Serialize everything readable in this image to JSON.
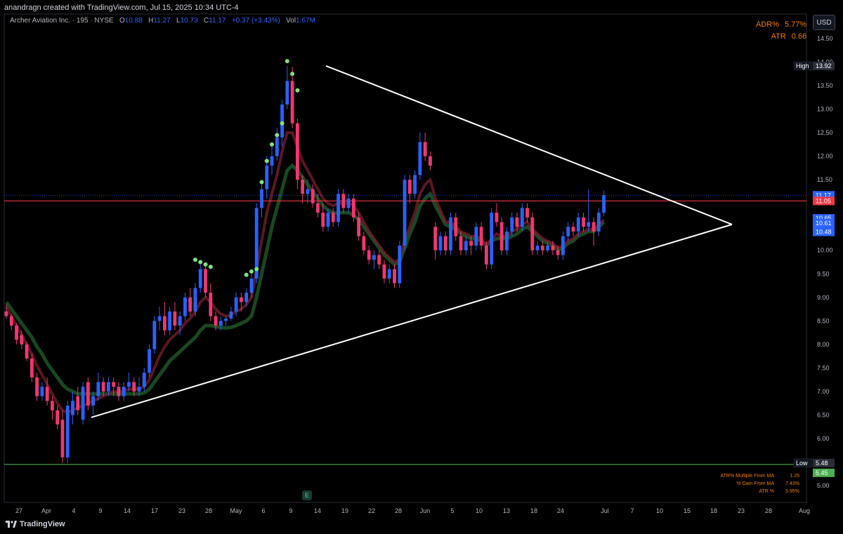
{
  "header": {
    "attribution": "anandragn created with TradingView.com, Jul 15, 2025 10:34 UTC-4"
  },
  "legend": {
    "symbol": "Archer Aviation Inc. · 195 · NYSE",
    "o_label": "O",
    "o_value": "10.88",
    "h_label": "H",
    "h_value": "11.27",
    "l_label": "L",
    "l_value": "10.73",
    "c_label": "C",
    "c_value": "11.17",
    "change": "+0.37 (+3.43%)",
    "vol_label": "Vol",
    "vol_value": "1.67M"
  },
  "currency_button": "USD",
  "indicators": {
    "adr_label": "ADR%",
    "adr_value": "5.77%",
    "atr_label": "ATR",
    "atr_value": "0.66"
  },
  "stats": [
    {
      "label": "ATR% Multiple From MA",
      "value": "1.25"
    },
    {
      "label": "% Gain From MA",
      "value": "7.43%"
    },
    {
      "label": "ATR %",
      "value": "5.95%"
    }
  ],
  "brand": "TradingView",
  "earnings_marker": "E",
  "colors": {
    "up": "#2962ff",
    "down": "#f23670",
    "red_line": "#f23645",
    "green_line": "#4caf50",
    "triangle": "#ffffff",
    "dots": "#7ee37e",
    "ema_fast": "#7a1f2b",
    "ema_green": "#1e5a28"
  },
  "chart_data": {
    "type": "candlestick",
    "title": "Archer Aviation Inc. · 195 · NYSE",
    "y_axis": {
      "min": 5.0,
      "max": 14.5,
      "ticks": [
        "14.50",
        "14.00",
        "13.50",
        "13.00",
        "12.50",
        "12.00",
        "11.50",
        "11.00",
        "10.50",
        "10.00",
        "9.50",
        "9.00",
        "8.50",
        "8.00",
        "7.50",
        "7.00",
        "6.50",
        "6.00",
        "5.50",
        "5.00"
      ]
    },
    "x_axis": {
      "ticks": [
        "27",
        "Apr",
        "4",
        "9",
        "14",
        "17",
        "23",
        "28",
        "May",
        "6",
        "9",
        "14",
        "19",
        "22",
        "28",
        "Jun",
        "5",
        "10",
        "13",
        "18",
        "24",
        "Jul",
        "7",
        "10",
        "15",
        "18",
        "23",
        "28",
        "Aug"
      ]
    },
    "price_labels": [
      {
        "text": "High",
        "value": "13.92",
        "price": 13.92,
        "color": "#2a2e39"
      },
      {
        "text": "",
        "value": "11.17",
        "price": 11.17,
        "color": "#2962ff"
      },
      {
        "text": "",
        "value": "11.05",
        "price": 11.05,
        "color": "#f23645"
      },
      {
        "text": "",
        "value": "10.65",
        "price": 10.65,
        "color": "#2962ff"
      },
      {
        "text": "",
        "value": "10.61",
        "price": 10.61,
        "color": "#2962ff"
      },
      {
        "text": "",
        "value": "10.49",
        "price": 10.49,
        "color": "#2962ff"
      },
      {
        "text": "",
        "value": "10.48",
        "price": 10.48,
        "color": "#2962ff"
      },
      {
        "text": "Low",
        "value": "5.48",
        "price": 5.48,
        "color": "#2a2e39"
      },
      {
        "text": "",
        "value": "5.45",
        "price": 5.45,
        "color": "#4caf50"
      }
    ],
    "horizontal_lines": [
      {
        "price": 11.05,
        "color": "#f23645"
      },
      {
        "price": 5.45,
        "color": "#4caf50"
      }
    ],
    "trendlines": [
      {
        "from": [
          0.248,
          13.92
        ],
        "to": [
          1.0,
          10.55
        ]
      },
      {
        "from": [
          0.06,
          6.45
        ],
        "to": [
          1.0,
          10.55
        ]
      }
    ],
    "candles": [
      [
        8.7,
        8.85,
        8.55,
        8.6
      ],
      [
        8.6,
        8.65,
        8.3,
        8.4
      ],
      [
        8.4,
        8.45,
        8.0,
        8.1
      ],
      [
        8.2,
        8.3,
        7.9,
        8.0
      ],
      [
        8.0,
        8.05,
        7.65,
        7.7
      ],
      [
        7.7,
        7.8,
        7.2,
        7.3
      ],
      [
        7.3,
        7.4,
        6.8,
        6.9
      ],
      [
        6.9,
        7.2,
        6.8,
        7.1
      ],
      [
        7.1,
        7.3,
        6.7,
        6.8
      ],
      [
        6.8,
        6.9,
        6.4,
        6.6
      ],
      [
        6.6,
        6.7,
        6.2,
        6.3
      ],
      [
        6.4,
        6.6,
        5.48,
        5.6
      ],
      [
        5.6,
        6.8,
        5.48,
        6.7
      ],
      [
        6.5,
        7.0,
        6.3,
        6.8
      ],
      [
        6.9,
        7.1,
        6.5,
        6.6
      ],
      [
        6.4,
        7.2,
        6.3,
        7.1
      ],
      [
        7.2,
        7.3,
        6.6,
        6.7
      ],
      [
        6.7,
        7.0,
        6.5,
        6.9
      ],
      [
        6.9,
        7.4,
        6.8,
        7.2
      ],
      [
        7.2,
        7.3,
        6.9,
        7.0
      ],
      [
        7.0,
        7.3,
        6.9,
        7.2
      ],
      [
        7.2,
        7.3,
        6.9,
        7.1
      ],
      [
        7.1,
        7.2,
        6.8,
        6.9
      ],
      [
        6.9,
        7.2,
        6.8,
        7.1
      ],
      [
        7.1,
        7.4,
        7.0,
        7.2
      ],
      [
        7.2,
        7.3,
        6.9,
        7.0
      ],
      [
        7.0,
        7.3,
        6.9,
        7.1
      ],
      [
        7.1,
        7.5,
        7.0,
        7.4
      ],
      [
        7.4,
        8.0,
        7.3,
        7.9
      ],
      [
        7.9,
        8.6,
        7.8,
        8.5
      ],
      [
        8.5,
        8.8,
        8.3,
        8.6
      ],
      [
        8.6,
        8.9,
        8.2,
        8.3
      ],
      [
        8.3,
        8.8,
        8.2,
        8.7
      ],
      [
        8.7,
        8.9,
        8.3,
        8.4
      ],
      [
        8.4,
        8.7,
        8.2,
        8.6
      ],
      [
        8.6,
        9.1,
        8.5,
        9.0
      ],
      [
        9.0,
        9.2,
        8.6,
        8.7
      ],
      [
        8.7,
        9.3,
        8.6,
        9.2
      ],
      [
        9.2,
        9.7,
        9.1,
        9.6
      ],
      [
        9.6,
        9.7,
        9.0,
        9.1
      ],
      [
        9.1,
        9.3,
        8.5,
        8.6
      ],
      [
        8.6,
        8.7,
        8.3,
        8.4
      ],
      [
        8.4,
        8.6,
        8.3,
        8.5
      ],
      [
        8.5,
        8.6,
        8.4,
        8.55
      ],
      [
        8.55,
        8.8,
        8.5,
        8.7
      ],
      [
        8.7,
        9.1,
        8.6,
        9.0
      ],
      [
        9.0,
        9.1,
        8.7,
        8.9
      ],
      [
        8.9,
        9.2,
        8.8,
        9.1
      ],
      [
        9.1,
        9.5,
        9.0,
        9.4
      ],
      [
        9.4,
        11.0,
        9.3,
        10.9
      ],
      [
        10.9,
        11.4,
        10.7,
        11.3
      ],
      [
        11.3,
        12.0,
        11.1,
        11.8
      ],
      [
        11.8,
        12.3,
        11.6,
        12.0
      ],
      [
        12.0,
        12.6,
        11.9,
        12.4
      ],
      [
        12.4,
        13.2,
        12.2,
        13.1
      ],
      [
        13.1,
        13.92,
        13.0,
        13.6
      ],
      [
        13.6,
        13.9,
        12.6,
        12.7
      ],
      [
        12.7,
        12.8,
        11.3,
        11.5
      ],
      [
        11.5,
        11.6,
        11.0,
        11.2
      ],
      [
        11.2,
        11.5,
        11.0,
        11.3
      ],
      [
        11.3,
        11.4,
        10.9,
        11.0
      ],
      [
        11.0,
        11.2,
        10.7,
        10.8
      ],
      [
        10.8,
        11.0,
        10.4,
        10.5
      ],
      [
        10.5,
        10.9,
        10.4,
        10.8
      ],
      [
        10.8,
        10.9,
        10.5,
        10.6
      ],
      [
        10.6,
        11.3,
        10.5,
        11.2
      ],
      [
        11.2,
        11.3,
        10.8,
        10.9
      ],
      [
        10.9,
        11.2,
        10.8,
        11.1
      ],
      [
        11.1,
        11.2,
        10.6,
        10.7
      ],
      [
        10.7,
        10.8,
        10.2,
        10.3
      ],
      [
        10.3,
        10.4,
        9.9,
        10.0
      ],
      [
        10.0,
        10.1,
        9.7,
        9.8
      ],
      [
        9.8,
        10.0,
        9.6,
        9.9
      ],
      [
        9.9,
        10.0,
        9.6,
        9.7
      ],
      [
        9.7,
        9.8,
        9.3,
        9.4
      ],
      [
        9.4,
        9.7,
        9.3,
        9.6
      ],
      [
        9.6,
        9.7,
        9.2,
        9.3
      ],
      [
        9.3,
        10.2,
        9.2,
        10.1
      ],
      [
        10.1,
        11.6,
        10.0,
        11.5
      ],
      [
        11.5,
        11.6,
        11.0,
        11.2
      ],
      [
        11.2,
        11.7,
        11.1,
        11.6
      ],
      [
        11.6,
        12.5,
        11.5,
        12.3
      ],
      [
        12.3,
        12.5,
        11.9,
        12.0
      ],
      [
        12.0,
        12.1,
        11.7,
        11.8
      ],
      [
        10.5,
        10.6,
        9.8,
        10.0
      ],
      [
        10.0,
        10.4,
        9.9,
        10.3
      ],
      [
        10.3,
        10.4,
        9.9,
        10.0
      ],
      [
        10.0,
        10.8,
        9.9,
        10.7
      ],
      [
        10.7,
        10.8,
        10.2,
        10.3
      ],
      [
        10.3,
        10.4,
        9.9,
        10.0
      ],
      [
        10.0,
        10.3,
        9.9,
        10.2
      ],
      [
        10.2,
        10.3,
        9.9,
        10.1
      ],
      [
        10.1,
        10.6,
        10.0,
        10.5
      ],
      [
        10.5,
        10.6,
        10.0,
        10.1
      ],
      [
        10.1,
        10.2,
        9.6,
        9.7
      ],
      [
        9.7,
        10.9,
        9.6,
        10.8
      ],
      [
        10.8,
        11.0,
        10.5,
        10.6
      ],
      [
        10.6,
        10.7,
        9.9,
        10.0
      ],
      [
        10.0,
        10.5,
        9.9,
        10.4
      ],
      [
        10.4,
        10.8,
        10.3,
        10.7
      ],
      [
        10.7,
        10.8,
        10.4,
        10.5
      ],
      [
        10.5,
        11.0,
        10.4,
        10.9
      ],
      [
        10.9,
        11.0,
        10.6,
        10.7
      ],
      [
        10.7,
        10.8,
        9.9,
        10.0
      ],
      [
        10.0,
        10.2,
        9.9,
        10.1
      ],
      [
        10.1,
        10.2,
        9.9,
        10.0
      ],
      [
        10.0,
        10.2,
        9.95,
        10.1
      ],
      [
        10.1,
        10.2,
        9.9,
        10.0
      ],
      [
        10.0,
        10.1,
        9.8,
        9.9
      ],
      [
        9.9,
        10.4,
        9.8,
        10.3
      ],
      [
        10.3,
        10.6,
        10.2,
        10.5
      ],
      [
        10.5,
        10.6,
        10.3,
        10.4
      ],
      [
        10.4,
        10.8,
        10.3,
        10.7
      ],
      [
        10.7,
        10.8,
        10.4,
        10.5
      ],
      [
        10.5,
        11.3,
        10.4,
        10.6
      ],
      [
        10.6,
        10.7,
        10.1,
        10.4
      ],
      [
        10.4,
        10.9,
        10.3,
        10.8
      ],
      [
        10.8,
        11.27,
        10.73,
        11.17
      ]
    ],
    "ema_fast": [
      8.8,
      8.6,
      8.4,
      8.2,
      8.0,
      7.8,
      7.55,
      7.35,
      7.15,
      6.95,
      6.75,
      6.6,
      6.55,
      6.6,
      6.65,
      6.7,
      6.75,
      6.8,
      6.85,
      6.9,
      6.95,
      7.0,
      7.0,
      7.0,
      7.05,
      7.05,
      7.05,
      7.1,
      7.25,
      7.5,
      7.75,
      7.95,
      8.1,
      8.2,
      8.3,
      8.45,
      8.55,
      8.7,
      8.9,
      9.0,
      8.9,
      8.75,
      8.65,
      8.6,
      8.62,
      8.7,
      8.75,
      8.85,
      9.0,
      9.6,
      10.2,
      10.8,
      11.2,
      11.6,
      12.1,
      12.5,
      12.5,
      12.2,
      11.9,
      11.7,
      11.5,
      11.3,
      11.1,
      11.0,
      10.95,
      11.0,
      11.0,
      11.0,
      10.95,
      10.8,
      10.6,
      10.4,
      10.25,
      10.1,
      9.95,
      9.85,
      9.75,
      9.8,
      10.2,
      10.5,
      10.8,
      11.2,
      11.4,
      11.5,
      11.1,
      10.85,
      10.6,
      10.6,
      10.5,
      10.4,
      10.35,
      10.3,
      10.3,
      10.25,
      10.1,
      10.25,
      10.35,
      10.3,
      10.3,
      10.4,
      10.45,
      10.55,
      10.6,
      10.45,
      10.35,
      10.25,
      10.2,
      10.15,
      10.05,
      10.1,
      10.2,
      10.25,
      10.35,
      10.4,
      10.45,
      10.45,
      10.55,
      10.65
    ],
    "ema_green": [
      8.9,
      8.75,
      8.6,
      8.45,
      8.3,
      8.15,
      7.95,
      7.8,
      7.6,
      7.45,
      7.3,
      7.15,
      7.05,
      7.0,
      6.95,
      6.95,
      6.95,
      6.95,
      6.95,
      6.95,
      6.95,
      6.95,
      6.95,
      6.95,
      6.95,
      6.95,
      6.95,
      6.97,
      7.05,
      7.2,
      7.35,
      7.5,
      7.65,
      7.75,
      7.85,
      7.95,
      8.05,
      8.15,
      8.3,
      8.4,
      8.4,
      8.38,
      8.36,
      8.35,
      8.36,
      8.4,
      8.45,
      8.5,
      8.6,
      9.0,
      9.5,
      10.0,
      10.5,
      10.9,
      11.3,
      11.7,
      11.8,
      11.7,
      11.55,
      11.4,
      11.25,
      11.1,
      10.95,
      10.85,
      10.8,
      10.8,
      10.8,
      10.8,
      10.75,
      10.65,
      10.5,
      10.35,
      10.2,
      10.05,
      9.9,
      9.8,
      9.7,
      9.75,
      10.05,
      10.35,
      10.6,
      10.95,
      11.1,
      11.2,
      10.95,
      10.75,
      10.55,
      10.5,
      10.45,
      10.35,
      10.3,
      10.25,
      10.25,
      10.2,
      10.1,
      10.2,
      10.25,
      10.25,
      10.25,
      10.3,
      10.35,
      10.45,
      10.5,
      10.4,
      10.3,
      10.2,
      10.15,
      10.1,
      10.0,
      10.05,
      10.15,
      10.2,
      10.3,
      10.35,
      10.4,
      10.4,
      10.5,
      10.6
    ],
    "signal_dots": [
      [
        37,
        9.8
      ],
      [
        38,
        9.75
      ],
      [
        39,
        9.7
      ],
      [
        40,
        9.65
      ],
      [
        47,
        9.48
      ],
      [
        48,
        9.55
      ],
      [
        49,
        9.6
      ],
      [
        50,
        11.45
      ],
      [
        51,
        11.9
      ],
      [
        52,
        12.25
      ],
      [
        53,
        12.45
      ],
      [
        54,
        12.7
      ],
      [
        55,
        14.02
      ],
      [
        56,
        13.75
      ],
      [
        57,
        13.4
      ]
    ]
  }
}
